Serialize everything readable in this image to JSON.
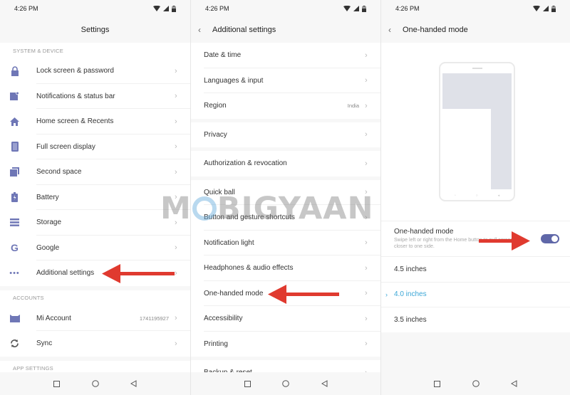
{
  "status_bar": {
    "time": "4:26 PM",
    "icons": [
      "wifi-icon",
      "signal-icon",
      "battery-icon"
    ]
  },
  "panel1": {
    "title": "Settings",
    "sections": [
      {
        "label": "SYSTEM & DEVICE",
        "items": [
          {
            "icon": "lock-icon",
            "label": "Lock screen & password"
          },
          {
            "icon": "notification-icon",
            "label": "Notifications & status bar"
          },
          {
            "icon": "home-icon",
            "label": "Home screen & Recents"
          },
          {
            "icon": "phone-screen-icon",
            "label": "Full screen display"
          },
          {
            "icon": "second-space-icon",
            "label": "Second space"
          },
          {
            "icon": "battery-icon",
            "label": "Battery"
          },
          {
            "icon": "storage-icon",
            "label": "Storage"
          },
          {
            "icon": "google-icon",
            "label": "Google"
          },
          {
            "icon": "more-dots-icon",
            "label": "Additional settings"
          }
        ]
      },
      {
        "label": "ACCOUNTS",
        "items": [
          {
            "icon": "mi-account-icon",
            "label": "Mi Account",
            "value": "1741195927"
          },
          {
            "icon": "sync-icon",
            "label": "Sync"
          }
        ]
      },
      {
        "label": "APP SETTINGS",
        "items": []
      }
    ]
  },
  "panel2": {
    "title": "Additional settings",
    "groups": [
      [
        {
          "label": "Date & time"
        },
        {
          "label": "Languages & input"
        },
        {
          "label": "Region",
          "value": "India"
        }
      ],
      [
        {
          "label": "Privacy"
        }
      ],
      [
        {
          "label": "Authorization & revocation"
        }
      ],
      [
        {
          "label": "Quick ball"
        },
        {
          "label": "Button and gesture shortcuts"
        },
        {
          "label": "Notification light"
        },
        {
          "label": "Headphones & audio effects"
        },
        {
          "label": "One-handed mode"
        },
        {
          "label": "Accessibility"
        },
        {
          "label": "Printing"
        }
      ],
      [
        {
          "label": "Backup & reset"
        }
      ]
    ]
  },
  "panel3": {
    "title": "One-handed mode",
    "toggle": {
      "title": "One-handed mode",
      "subtitle": "Swipe left or right from the Home button to pull screen closer to one side.",
      "enabled": true
    },
    "sizes": [
      {
        "label": "4.5 inches",
        "selected": false
      },
      {
        "label": "4.0 inches",
        "selected": true
      },
      {
        "label": "3.5 inches",
        "selected": false
      }
    ]
  },
  "watermark": {
    "text_left": "M",
    "text_right": "BIGYAAN"
  },
  "colors": {
    "accent": "#5f67a8",
    "selected": "#3aa6d6",
    "arrow": "#e03a2f",
    "icon": "#6f77b6"
  },
  "nav": [
    "recents-button",
    "home-button",
    "back-button"
  ]
}
